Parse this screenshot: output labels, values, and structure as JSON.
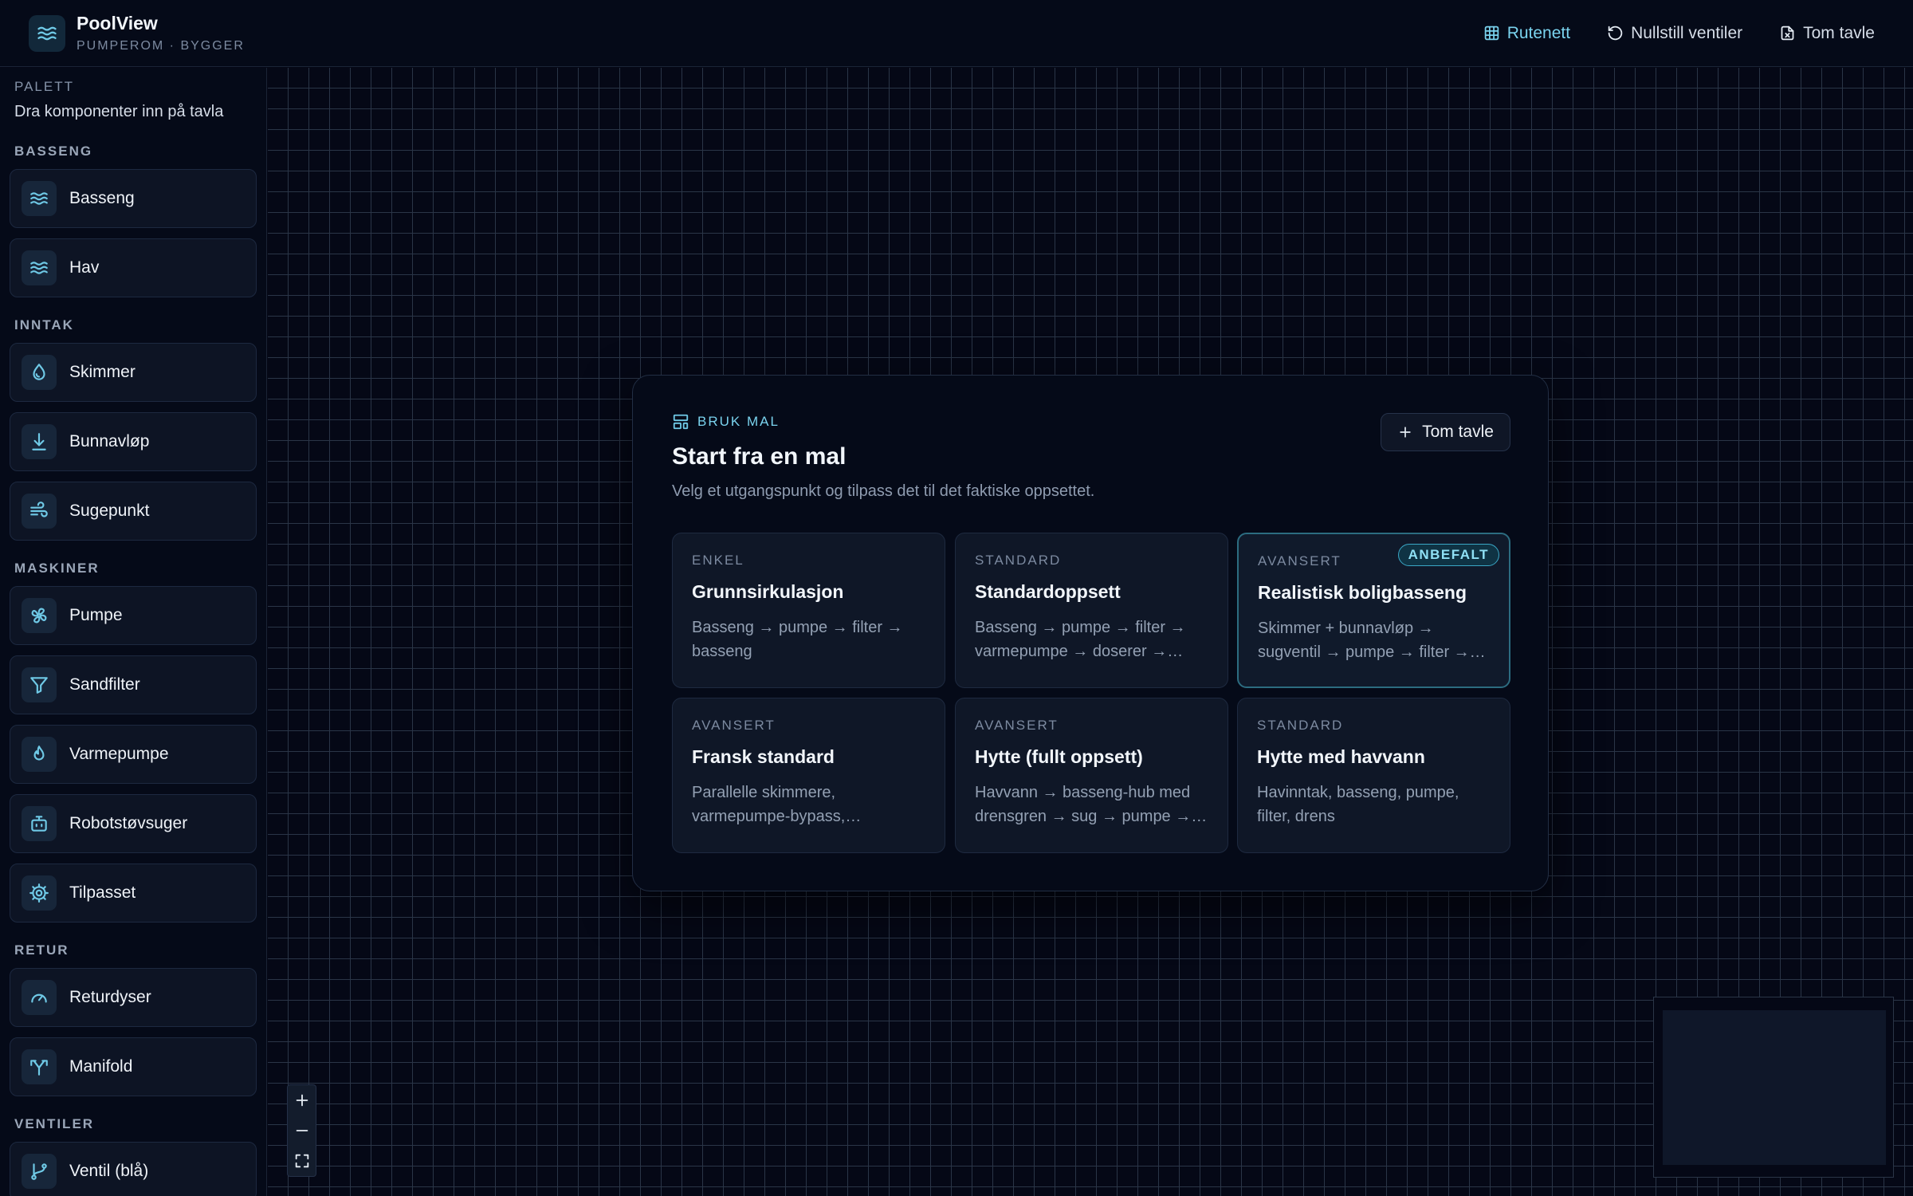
{
  "app": {
    "name": "PoolView",
    "subtitle": "PUMPEROM · BYGGER"
  },
  "toolbar": {
    "grid_label": "Rutenett",
    "reset_label": "Nullstill ventiler",
    "clear_label": "Tom tavle"
  },
  "palette": {
    "title": "PALETT",
    "subtitle": "Dra komponenter inn på tavla",
    "groups": [
      {
        "label": "BASSENG",
        "items": [
          {
            "label": "Basseng",
            "icon": "waves-icon"
          },
          {
            "label": "Hav",
            "icon": "waves-icon"
          }
        ]
      },
      {
        "label": "INNTAK",
        "items": [
          {
            "label": "Skimmer",
            "icon": "droplet-icon"
          },
          {
            "label": "Bunnavløp",
            "icon": "arrow-down-to-line-icon"
          },
          {
            "label": "Sugepunkt",
            "icon": "wind-icon"
          }
        ]
      },
      {
        "label": "MASKINER",
        "items": [
          {
            "label": "Pumpe",
            "icon": "fan-icon"
          },
          {
            "label": "Sandfilter",
            "icon": "filter-icon"
          },
          {
            "label": "Varmepumpe",
            "icon": "flame-icon"
          },
          {
            "label": "Robotstøvsuger",
            "icon": "bot-icon"
          },
          {
            "label": "Tilpasset",
            "icon": "cog-icon"
          }
        ]
      },
      {
        "label": "RETUR",
        "items": [
          {
            "label": "Returdyser",
            "icon": "gauge-icon"
          },
          {
            "label": "Manifold",
            "icon": "split-icon"
          }
        ]
      },
      {
        "label": "VENTILER",
        "items": [
          {
            "label": "Ventil (blå)",
            "icon": "git-branch-icon"
          }
        ]
      }
    ]
  },
  "template_dialog": {
    "eyebrow": "BRUK MAL",
    "title": "Start fra en mal",
    "subtitle": "Velg et utgangspunkt og tilpass det til det faktiske oppsettet.",
    "empty_button": "Tom tavle",
    "recommended_badge": "ANBEFALT",
    "cards": [
      {
        "tier": "ENKEL",
        "name": "Grunnsirkulasjon",
        "desc": "Basseng → pumpe → filter → basseng",
        "recommended": false
      },
      {
        "tier": "STANDARD",
        "name": "Standardoppsett",
        "desc": "Basseng → pumpe → filter → varmepumpe → doserer → basseng",
        "recommended": false
      },
      {
        "tier": "AVANSERT",
        "name": "Realistisk boligbasseng",
        "desc": "Skimmer + bunnavløp → sugventil → pumpe → filter → varmepumpe",
        "recommended": true
      },
      {
        "tier": "AVANSERT",
        "name": "Fransk standard",
        "desc": "Parallelle skimmere, varmepumpe-bypass, drensventil",
        "recommended": false
      },
      {
        "tier": "AVANSERT",
        "name": "Hytte (fullt oppsett)",
        "desc": "Havvann → basseng-hub med drensgren → sug → pumpe → filter",
        "recommended": false
      },
      {
        "tier": "STANDARD",
        "name": "Hytte med havvann",
        "desc": "Havinntak, basseng, pumpe, filter, drens",
        "recommended": false
      }
    ]
  },
  "colors": {
    "accent": "#6fc9e6",
    "background": "#050816",
    "panel": "#0f1727"
  }
}
